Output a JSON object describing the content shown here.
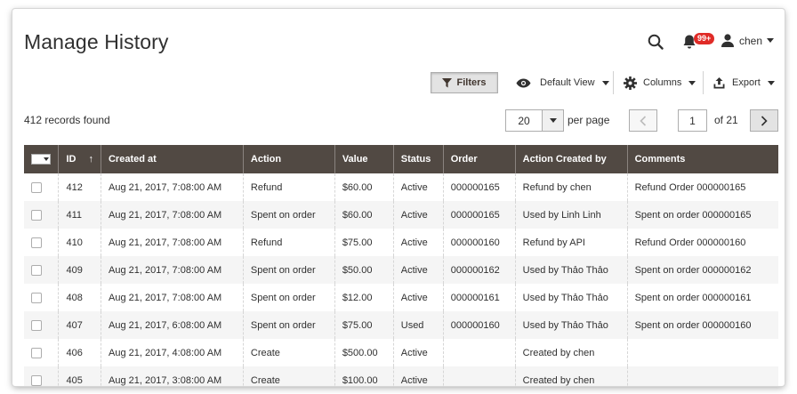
{
  "header": {
    "title": "Manage History",
    "notification_count": "99+",
    "user_name": "chen"
  },
  "toolbar": {
    "filters_label": "Filters",
    "view_label": "Default View",
    "columns_label": "Columns",
    "export_label": "Export"
  },
  "pager": {
    "records_found": "412 records found",
    "per_page_value": "20",
    "per_page_label": "per page",
    "current_page": "1",
    "of_pages": "of 21"
  },
  "table": {
    "columns": [
      "ID",
      "Created at",
      "Action",
      "Value",
      "Status",
      "Order",
      "Action Created by",
      "Comments"
    ],
    "sort_indicator": "↑",
    "rows": [
      [
        "412",
        "Aug 21, 2017, 7:08:00 AM",
        "Refund",
        "$60.00",
        "Active",
        "000000165",
        "Refund by chen",
        "Refund Order 000000165"
      ],
      [
        "411",
        "Aug 21, 2017, 7:08:00 AM",
        "Spent on order",
        "$60.00",
        "Active",
        "000000165",
        "Used by Linh Linh",
        "Spent on order 000000165"
      ],
      [
        "410",
        "Aug 21, 2017, 7:08:00 AM",
        "Refund",
        "$75.00",
        "Active",
        "000000160",
        "Refund by API",
        "Refund Order 000000160"
      ],
      [
        "409",
        "Aug 21, 2017, 7:08:00 AM",
        "Spent on order",
        "$50.00",
        "Active",
        "000000162",
        "Used by Thảo Thảo",
        "Spent on order 000000162"
      ],
      [
        "408",
        "Aug 21, 2017, 7:08:00 AM",
        "Spent on order",
        "$12.00",
        "Active",
        "000000161",
        "Used by Thảo Thảo",
        "Spent on order 000000161"
      ],
      [
        "407",
        "Aug 21, 2017, 6:08:00 AM",
        "Spent on order",
        "$75.00",
        "Used",
        "000000160",
        "Used by Thảo Thảo",
        "Spent on order 000000160"
      ],
      [
        "406",
        "Aug 21, 2017, 4:08:00 AM",
        "Create",
        "$500.00",
        "Active",
        "",
        "Created by chen",
        ""
      ],
      [
        "405",
        "Aug 21, 2017, 3:08:00 AM",
        "Create",
        "$100.00",
        "Active",
        "",
        "Created by chen",
        ""
      ]
    ]
  }
}
